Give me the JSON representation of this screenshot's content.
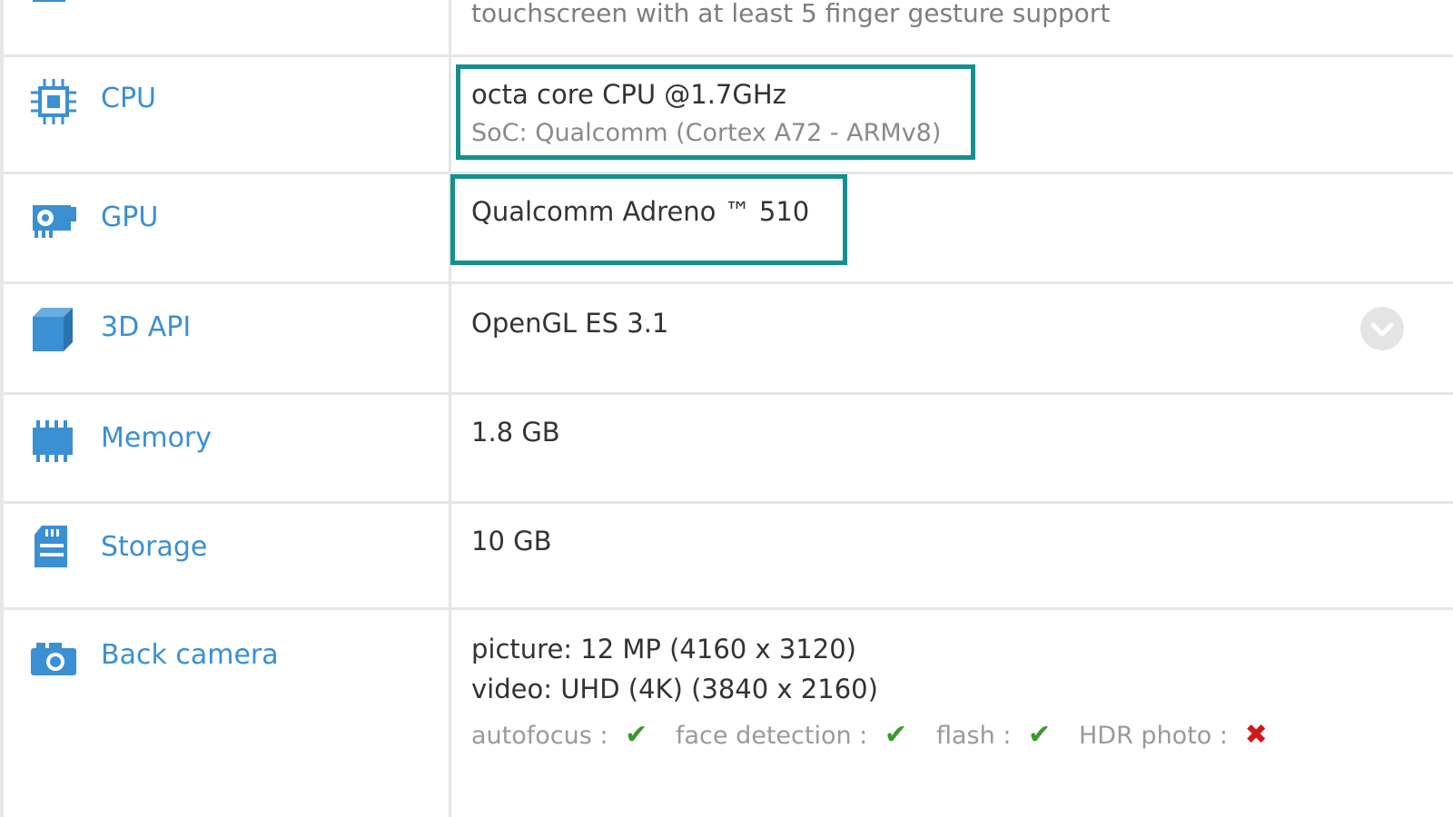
{
  "rows": [
    {
      "id": "screen",
      "label": "",
      "value": "touchscreen with at least 5 finger gesture support"
    },
    {
      "id": "cpu",
      "label": "CPU",
      "value": "octa core CPU @1.7GHz",
      "sub": "SoC: Qualcomm (Cortex A72 - ARMv8)"
    },
    {
      "id": "gpu",
      "label": "GPU",
      "value": "Qualcomm Adreno ™ 510"
    },
    {
      "id": "api",
      "label": "3D API",
      "value": "OpenGL ES 3.1"
    },
    {
      "id": "memory",
      "label": "Memory",
      "value": "1.8 GB"
    },
    {
      "id": "storage",
      "label": "Storage",
      "value": "10 GB"
    },
    {
      "id": "camera",
      "label": "Back camera",
      "value": "picture: 12 MP (4160 x 3120)",
      "value2": "video: UHD (4K) (3840 x 2160)"
    }
  ],
  "camera_features": [
    {
      "label": "autofocus :",
      "supported": true,
      "mark": "✔"
    },
    {
      "label": "face detection :",
      "supported": true,
      "mark": "✔"
    },
    {
      "label": "flash :",
      "supported": true,
      "mark": "✔"
    },
    {
      "label": "HDR photo :",
      "supported": false,
      "mark": "✖"
    }
  ],
  "colors": {
    "label_blue": "#3b8fd3",
    "highlight_teal": "#13908d",
    "check_green": "#3a9a2a",
    "cross_red": "#d21919"
  },
  "icons": [
    "screen-icon",
    "cpu-icon",
    "gpu-icon",
    "3d-api-icon",
    "memory-icon",
    "storage-icon",
    "camera-icon",
    "chevron-down-icon"
  ]
}
